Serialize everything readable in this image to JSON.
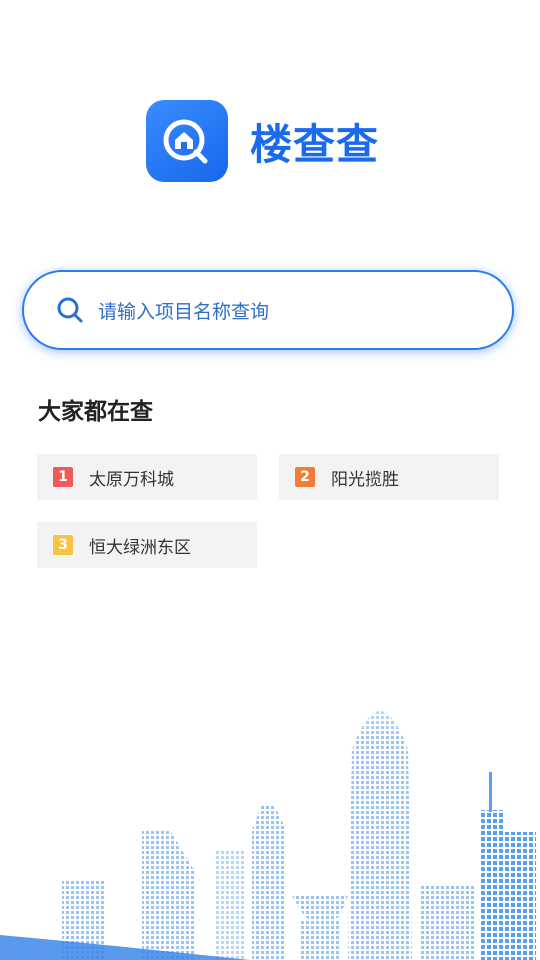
{
  "app": {
    "name": "楼查查",
    "icon": "house-search-icon"
  },
  "search": {
    "placeholder": "请输入项目名称查询",
    "icon": "search-icon"
  },
  "hot": {
    "title": "大家都在查",
    "items": [
      {
        "rank": "1",
        "label": "太原万科城",
        "color": "#ef5a5a"
      },
      {
        "rank": "2",
        "label": "阳光揽胜",
        "color": "#f07d3a"
      },
      {
        "rank": "3",
        "label": "恒大绿洲东区",
        "color": "#f6c343"
      }
    ]
  },
  "colors": {
    "brand": "#1a6af0",
    "border": "#2b7bf2"
  }
}
